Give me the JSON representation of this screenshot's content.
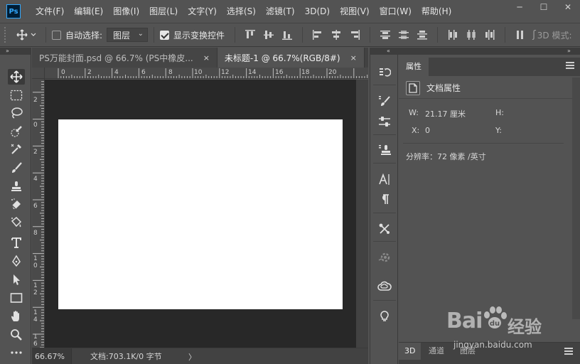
{
  "app": {
    "logo_text": "Ps",
    "menus": [
      "文件(F)",
      "编辑(E)",
      "图像(I)",
      "图层(L)",
      "文字(Y)",
      "选择(S)",
      "滤镜(T)",
      "3D(D)",
      "视图(V)",
      "窗口(W)",
      "帮助(H)"
    ],
    "window_controls": [
      "─",
      "☐",
      "✕"
    ]
  },
  "options": {
    "auto_select_label": "自动选择:",
    "auto_select_checked": false,
    "layer_select_value": "图层",
    "show_transform_label": "显示变换控件",
    "show_transform_checked": true,
    "mode_3d_label": "3D 模式:"
  },
  "tabs": [
    {
      "label": "PS万能封面.psd @ 66.7% (PS中橡皮...",
      "close": "×",
      "active": false
    },
    {
      "label": "未标题-1 @ 66.7%(RGB/8#)",
      "close": "×",
      "active": true
    }
  ],
  "rulers": {
    "horizontal": [
      "0",
      "2",
      "4",
      "6",
      "8",
      "10",
      "12",
      "14",
      "16",
      "18",
      "20"
    ],
    "vertical": [
      "2",
      "0",
      "2",
      "4",
      "6",
      "8",
      "1\n0",
      "1\n2",
      "1\n4",
      "1\n6"
    ]
  },
  "status": {
    "zoom": "66.67%",
    "doc_info": "文档:703.1K/0 字节",
    "arrow": "〉"
  },
  "properties": {
    "tab_label": "属性",
    "section_title": "文档属性",
    "w_label": "W:",
    "w_value": "21.17 厘米",
    "h_label": "H:",
    "x_label": "X:",
    "x_value": "0",
    "y_label": "Y:",
    "resolution": "分辨率：72 像素 /英寸"
  },
  "bottom_tabs": [
    "3D",
    "通道",
    "图层"
  ],
  "watermark": {
    "brand": "Bai",
    "brand_suffix": "经验",
    "url": "jingyan.baidu.com"
  },
  "colors": {
    "ui_bg": "#535353",
    "canvas_bg": "#282828",
    "document": "#ffffff",
    "ps_accent": "#31a8ff"
  }
}
